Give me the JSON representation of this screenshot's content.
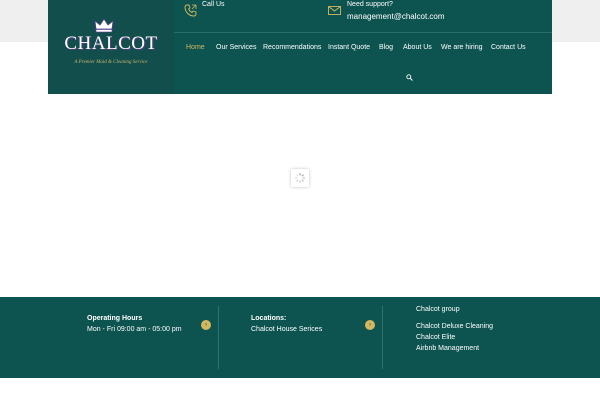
{
  "brand": {
    "logo_text": "CHALCOT",
    "tagline": "A Premier Maid & Cleaning Service"
  },
  "contact": {
    "call_label": "Call Us",
    "support_label": "Need support?",
    "email": "management@chalcot.com"
  },
  "nav": {
    "items": [
      "Home",
      "Our Services",
      "Recommendations",
      "Instant Quote",
      "Blog",
      "About Us",
      "We are hiring",
      "Contact Us"
    ],
    "active": "Home"
  },
  "footer": {
    "hours_title": "Operating Hours",
    "hours_text": "Mon - Fri 09:00 am - 05:00 pm",
    "locations_title": "Locations:",
    "locations_text": "Chalcot House Serices",
    "group_items": [
      "Chalcot group",
      "Chalcot Deluxe Cleaning",
      "Chalcot Elite",
      "Airbnb Management"
    ]
  },
  "colors": {
    "header_bg": "#0d5451",
    "accent": "#d4b85f",
    "topstrip": "#efefef"
  }
}
